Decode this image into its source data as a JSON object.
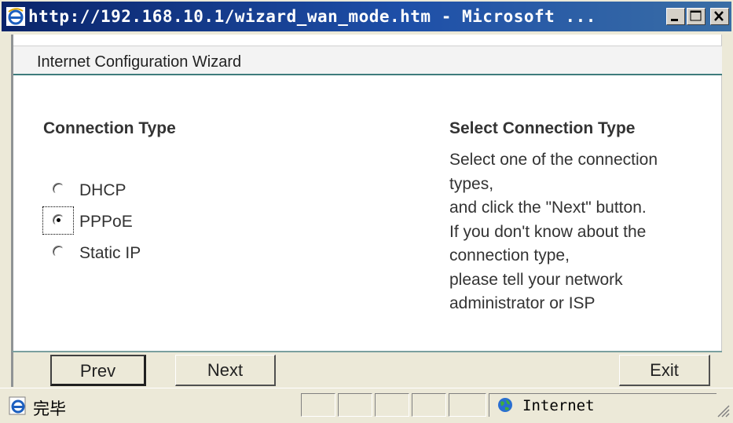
{
  "window": {
    "title": "http://192.168.10.1/wizard_wan_mode.htm - Microsoft ...",
    "controls": [
      "minimize",
      "maximize",
      "close"
    ]
  },
  "wizard": {
    "header": "Internet Configuration Wizard",
    "connection_type_heading": "Connection Type",
    "options": [
      {
        "label": "DHCP",
        "selected": false
      },
      {
        "label": "PPPoE",
        "selected": true
      },
      {
        "label": "Static IP",
        "selected": false
      }
    ],
    "help_heading": "Select Connection Type",
    "help_lines": [
      "Select one of the connection",
      "types,",
      "and click the \"Next\" button.",
      "If you don't know about the",
      "connection type,",
      "please tell your network",
      "administrator or ISP"
    ]
  },
  "buttons": {
    "prev": "Prev",
    "next": "Next",
    "exit": "Exit"
  },
  "statusbar": {
    "status_text": "完毕",
    "zone": "Internet"
  },
  "colors": {
    "titlebar": "#0a246a",
    "header_rule": "#3e7c7c",
    "chrome": "#ece9d8"
  }
}
